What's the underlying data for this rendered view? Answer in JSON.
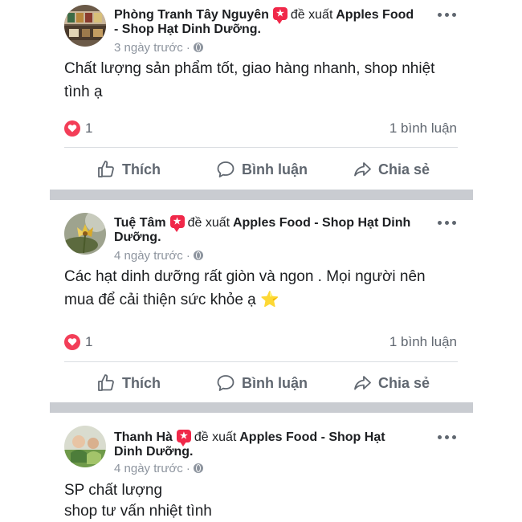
{
  "posts": [
    {
      "author": "Phòng Tranh Tây Nguyên",
      "recommends_text": "đề xuất",
      "page_name_line1": "Apples Food",
      "page_name_line2": "- Shop Hạt Dinh Dưỡng.",
      "time": "3 ngày trước ·",
      "text_lines": [
        "Chất lượng sản phẩm tốt, giao hàng nhanh, shop nhiệt",
        "tình ạ"
      ],
      "reaction_count": "1",
      "comment_count": "1 bình luận",
      "avatar_icon": "shop-avatar"
    },
    {
      "author": "Tuệ Tâm",
      "recommends_text": "đề xuất",
      "page_name_line1": "Apples Food - Shop Hạt Dinh",
      "page_name_line2": "Dưỡng.",
      "time": "4 ngày trước ·",
      "text_lines": [
        "Các hạt dinh dưỡng rất giòn và ngon . Mọi người nên",
        "mua để cải thiện sức khỏe ạ ⭐"
      ],
      "reaction_count": "1",
      "comment_count": "1 bình luận",
      "avatar_icon": "flower-avatar"
    },
    {
      "author": "Thanh Hà",
      "recommends_text": "đề xuất",
      "page_name_line1": "Apples Food - Shop Hạt",
      "page_name_line2": "Dinh Dưỡng.",
      "time": "4 ngày trước ·",
      "text_lines": [
        "SP chất lượng",
        "shop tư vấn nhiệt tình"
      ],
      "avatar_icon": "child-avatar"
    }
  ],
  "actions": {
    "like": "Thích",
    "comment": "Bình luận",
    "share": "Chia sẻ"
  },
  "colors": {
    "reaction": "#f33e58",
    "recommend_badge": "#f02849",
    "separator": "#c9ccd1",
    "secondary_text": "#606770"
  }
}
